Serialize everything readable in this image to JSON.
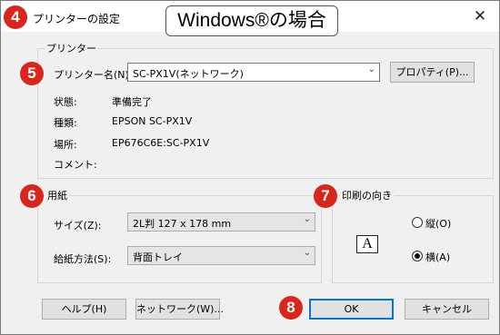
{
  "window": {
    "title": "プリンターの設定",
    "close_glyph": "✕"
  },
  "banner": {
    "text": "Windows®の場合"
  },
  "markers": {
    "m4": "4",
    "m5": "5",
    "m6": "6",
    "m7": "7",
    "m8": "8"
  },
  "printer_group": {
    "label": "プリンター",
    "name_label": "プリンター名(N):",
    "name_value": "SC-PX1V(ネットワーク)",
    "properties_button": "プロパティ(P)...",
    "status_label": "状態:",
    "status_value": "準備完了",
    "type_label": "種類:",
    "type_value": "EPSON SC-PX1V",
    "location_label": "場所:",
    "location_value": "EP676C6E:SC-PX1V",
    "comment_label": "コメント:",
    "comment_value": ""
  },
  "paper_group": {
    "label": "用紙",
    "size_label": "サイズ(Z):",
    "size_value": "2L判 127 x 178 mm",
    "source_label": "給紙方法(S):",
    "source_value": "背面トレイ"
  },
  "orientation_group": {
    "label": "印刷の向き",
    "icon_letter": "A",
    "portrait_label": "縦(O)",
    "landscape_label": "横(A)",
    "selected": "landscape"
  },
  "footer": {
    "help_button": "ヘルプ(H)",
    "network_button": "ネットワーク(W)...",
    "ok_button": "OK",
    "cancel_button": "キャンセル"
  },
  "icons": {
    "dropdown": "chevron-down-icon",
    "close": "close-icon"
  },
  "colors": {
    "marker_red": "#d9261c",
    "default_button_border": "#0078d7",
    "dialog_bg": "#f0f0f0"
  }
}
